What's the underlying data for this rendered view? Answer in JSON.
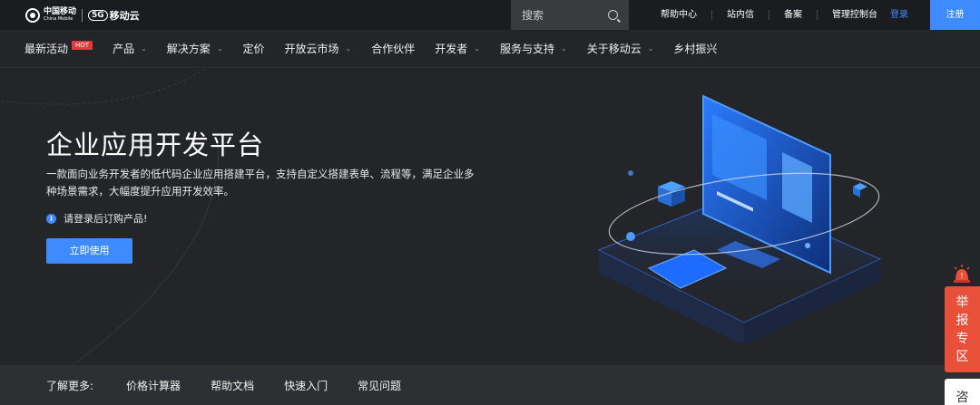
{
  "topbar": {
    "logo_cn": "中国移动",
    "logo_en": "China Mobile",
    "logo_cloud": "移动云",
    "logo_g": "5G",
    "search_placeholder": "搜索",
    "links": [
      "帮助中心",
      "站内信",
      "备案",
      "管理控制台"
    ],
    "login": "登录",
    "register": "注册"
  },
  "nav": {
    "items": [
      {
        "label": "最新活动",
        "badge": "HOT",
        "dropdown": false
      },
      {
        "label": "产品",
        "dropdown": true
      },
      {
        "label": "解决方案",
        "dropdown": true
      },
      {
        "label": "定价",
        "dropdown": false
      },
      {
        "label": "开放云市场",
        "dropdown": true
      },
      {
        "label": "合作伙伴",
        "dropdown": false
      },
      {
        "label": "开发者",
        "dropdown": true
      },
      {
        "label": "服务与支持",
        "dropdown": true
      },
      {
        "label": "关于移动云",
        "dropdown": true
      },
      {
        "label": "乡村振兴",
        "dropdown": false
      }
    ]
  },
  "hero": {
    "title": "企业应用开发平台",
    "description": "一款面向业务开发者的低代码企业应用搭建平台，支持自定义搭建表单、流程等，满足企业多种场景需求，大幅度提升应用开发效率。",
    "notice": "请登录后订购产品!",
    "cta": "立即使用"
  },
  "more": {
    "label": "了解更多:",
    "links": [
      "价格计算器",
      "帮助文档",
      "快速入门",
      "常见问题"
    ]
  },
  "float": {
    "report": [
      "举",
      "报",
      "专",
      "区"
    ],
    "consult": "咨"
  },
  "colors": {
    "accent": "#3e8bff",
    "hot": "#e4393c",
    "report": "#e8503a"
  }
}
